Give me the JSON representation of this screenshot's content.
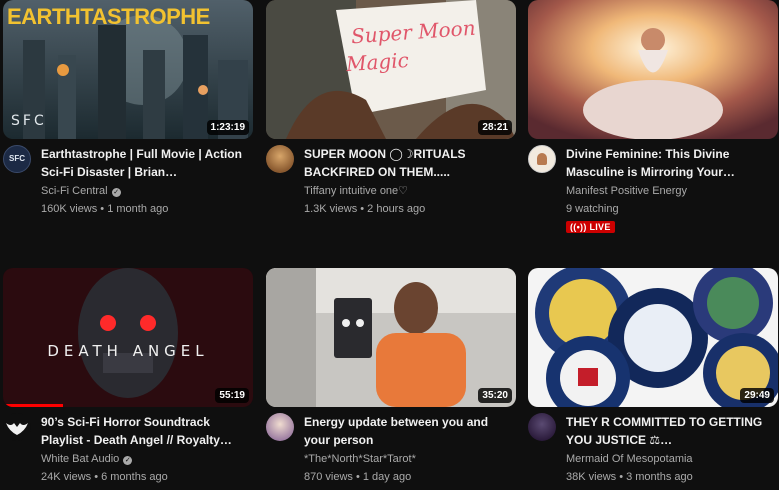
{
  "videos": [
    {
      "title": "Earthtastrophe | Full Movie | Action Sci-Fi Disaster | Brian…",
      "channel": "Sci-Fi Central",
      "verified": true,
      "meta": "160K views • 1 month ago",
      "duration": "1:23:19",
      "thumb_text": "EARTHTASTROPHE",
      "thumb_brand": "SFC",
      "avatar_text": "SFC"
    },
    {
      "title": "SUPER MOON ◯☽RITUALS BACKFIRED ON THEM.....",
      "channel": "Tiffany intuitive one♡",
      "verified": false,
      "meta": "1.3K views • 2 hours ago",
      "duration": "28:21",
      "thumb_text_1": "Super Moon",
      "thumb_text_2": "Magic"
    },
    {
      "title": "Divine Feminine: This Divine Masculine is Mirroring Your…",
      "channel": "Manifest Positive Energy",
      "verified": false,
      "meta": "9 watching",
      "live_label": "LIVE",
      "live_icon": "((•))"
    },
    {
      "title": "90’s Sci-Fi Horror Soundtrack Playlist - Death Angel // Royalty…",
      "channel": "White Bat Audio",
      "verified": true,
      "meta": "24K views • 6 months ago",
      "duration": "55:19",
      "thumb_text": "DEATH ANGEL",
      "watch_progress": 0.24
    },
    {
      "title": "Energy update between you and your person",
      "channel": "*The*North*Star*Tarot*",
      "verified": false,
      "meta": "870 views • 1 day ago",
      "duration": "35:20"
    },
    {
      "title": "THEY R COMMITTED TO GETTING YOU JUSTICE ⚖…",
      "channel": "Mermaid Of Mesopotamia",
      "verified": false,
      "meta": "38K views • 3 months ago",
      "duration": "29:49"
    }
  ],
  "colors": {
    "background": "#0f0f0f",
    "text": "#f1f1f1",
    "secondary": "#aaaaaa",
    "live": "#cc0000",
    "progress": "#ff0000"
  }
}
